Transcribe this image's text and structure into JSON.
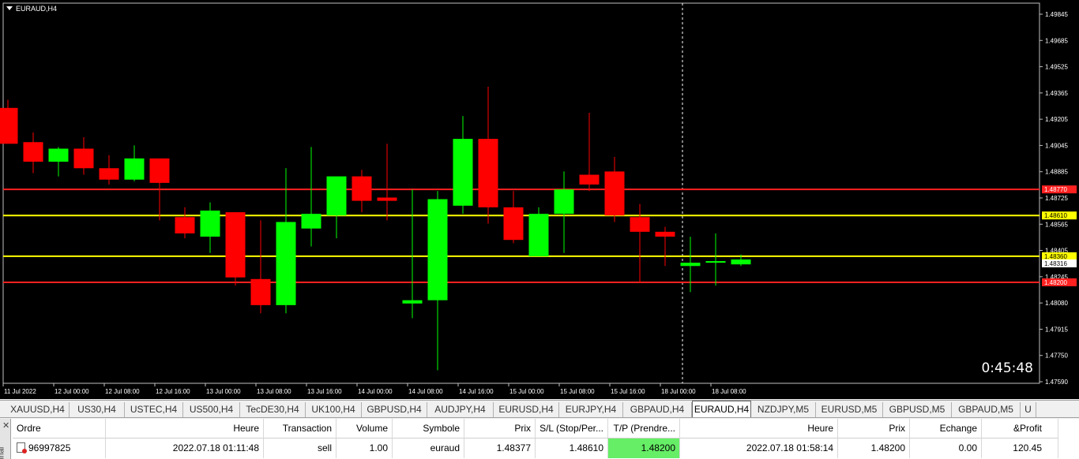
{
  "chart": {
    "title": "EURAUD,H4",
    "countdown": "0:45:48",
    "colors": {
      "bull": "#00ff00",
      "bear": "#ff0000",
      "background": "#000000"
    },
    "price_scale": [
      "1.49845",
      "1.49685",
      "1.49525",
      "1.49365",
      "1.49205",
      "1.49045",
      "1.48885",
      "1.48725",
      "1.48565",
      "1.48405",
      "1.48245",
      "1.48080",
      "1.47915",
      "1.47750",
      "1.47590"
    ],
    "time_labels": [
      "11 Jul 2022",
      "12 Jul 00:00",
      "12 Jul 08:00",
      "12 Jul 16:00",
      "13 Jul 00:00",
      "13 Jul 08:00",
      "13 Jul 16:00",
      "14 Jul 00:00",
      "14 Jul 08:00",
      "14 Jul 16:00",
      "15 Jul 00:00",
      "15 Jul 08:00",
      "15 Jul 16:00",
      "18 Jul 00:00",
      "18 Jul 08:00"
    ],
    "levels": [
      {
        "label": "1.48770",
        "price": 1.4877,
        "color": "#ff2020"
      },
      {
        "label": "1.48610",
        "price": 1.4861,
        "color": "#ffff00"
      },
      {
        "label": "1.48360",
        "price": 1.4836,
        "color": "#ffff00"
      },
      {
        "label": "1.48316",
        "price": 1.48316,
        "color": "#ffffff"
      },
      {
        "label": "1.48200",
        "price": 1.482,
        "color": "#ff2020"
      }
    ],
    "candles": [
      [
        1.4927,
        1.4932,
        1.4905,
        1.4905
      ],
      [
        1.4906,
        1.4912,
        1.4887,
        1.4894
      ],
      [
        1.4894,
        1.4903,
        1.4885,
        1.4902
      ],
      [
        1.4902,
        1.4909,
        1.4886,
        1.489
      ],
      [
        1.489,
        1.4898,
        1.488,
        1.4883
      ],
      [
        1.4883,
        1.4904,
        1.4882,
        1.4896
      ],
      [
        1.4896,
        1.4892,
        1.4858,
        1.4881
      ],
      [
        1.486,
        1.4866,
        1.4847,
        1.485
      ],
      [
        1.4848,
        1.4869,
        1.4838,
        1.4864
      ],
      [
        1.4863,
        1.4863,
        1.4818,
        1.4823
      ],
      [
        1.4822,
        1.4858,
        1.4801,
        1.4806
      ],
      [
        1.4806,
        1.489,
        1.4801,
        1.4857
      ],
      [
        1.4853,
        1.4903,
        1.4842,
        1.4862
      ],
      [
        1.4861,
        1.4878,
        1.4847,
        1.4885
      ],
      [
        1.4885,
        1.4889,
        1.4863,
        1.487
      ],
      [
        1.4872,
        1.4905,
        1.4858,
        1.487
      ],
      [
        1.4807,
        1.4877,
        1.4798,
        1.4809
      ],
      [
        1.4809,
        1.4876,
        1.4766,
        1.4871
      ],
      [
        1.4867,
        1.4922,
        1.4862,
        1.4908
      ],
      [
        1.4908,
        1.494,
        1.4856,
        1.4866
      ],
      [
        1.4866,
        1.4876,
        1.4844,
        1.4846
      ],
      [
        1.4836,
        1.4866,
        1.4836,
        1.4862
      ],
      [
        1.4862,
        1.4888,
        1.4838,
        1.4877
      ],
      [
        1.4886,
        1.4924,
        1.4876,
        1.488
      ],
      [
        1.4888,
        1.4897,
        1.4857,
        1.4861
      ],
      [
        1.486,
        1.4868,
        1.482,
        1.4851
      ],
      [
        1.4851,
        1.4854,
        1.483,
        1.4848
      ],
      [
        1.483,
        1.4848,
        1.4814,
        1.4832
      ],
      [
        1.4832,
        1.485,
        1.4818,
        1.4833
      ],
      [
        1.4831,
        1.4837,
        1.483,
        1.4834
      ]
    ]
  },
  "tabs": [
    "XAUUSD,H4",
    "US30,H4",
    "USTEC,H4",
    "US500,H4",
    "TecDE30,H4",
    "UK100,H4",
    "GBPUSD,H4",
    "AUDJPY,H4",
    "EURUSD,H4",
    "EURJPY,H4",
    "GBPAUD,H4",
    "EURAUD,H4",
    "NZDJPY,M5",
    "EURUSD,M5",
    "GBPUSD,M5",
    "GBPAUD,M5",
    "U"
  ],
  "active_tab": "EURAUD,H4",
  "terminal": {
    "side_label": "inal",
    "close_glyph": "✕",
    "columns": [
      "Ordre",
      "Heure",
      "Transaction",
      "Volume",
      "Symbole",
      "Prix",
      "S/L (Stop/Per...",
      "T/P (Prendre...",
      "Heure",
      "Prix",
      "Echange",
      "&Profit"
    ],
    "row": [
      "96997825",
      "2022.07.18 01:11:48",
      "sell",
      "1.00",
      "euraud",
      "1.48377",
      "1.48610",
      "1.48200",
      "2022.07.18 01:58:14",
      "1.48200",
      "0.00",
      "120.45"
    ]
  }
}
